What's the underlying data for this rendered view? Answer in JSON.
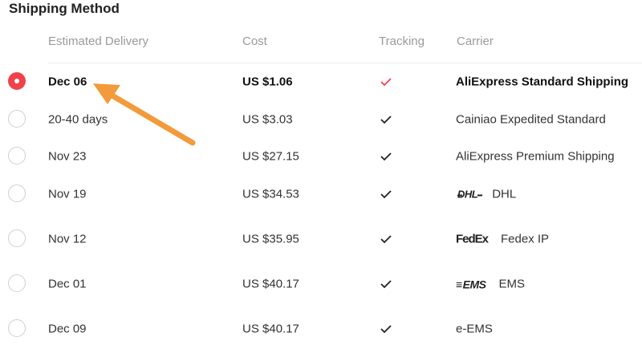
{
  "section_title": "Shipping Method",
  "columns": {
    "delivery": "Estimated Delivery",
    "cost": "Cost",
    "tracking": "Tracking",
    "carrier": "Carrier"
  },
  "rows": [
    {
      "delivery": "Dec 06",
      "cost": "US $1.06",
      "tracking": true,
      "carrier": "AliExpress Standard Shipping",
      "selected": true
    },
    {
      "delivery": "20-40 days",
      "cost": "US $3.03",
      "tracking": true,
      "carrier": "Cainiao Expedited Standard",
      "selected": false
    },
    {
      "delivery": "Nov 23",
      "cost": "US $27.15",
      "tracking": true,
      "carrier": "AliExpress Premium Shipping",
      "selected": false
    },
    {
      "delivery": "Nov 19",
      "cost": "US $34.53",
      "tracking": true,
      "carrier": "DHL",
      "logo": "DHL",
      "selected": false
    },
    {
      "delivery": "Nov 12",
      "cost": "US $35.95",
      "tracking": true,
      "carrier": "Fedex IP",
      "logo": "FedEx",
      "selected": false
    },
    {
      "delivery": "Dec 01",
      "cost": "US $40.17",
      "tracking": true,
      "carrier": "EMS",
      "logo": "EMS",
      "selected": false
    },
    {
      "delivery": "Dec 09",
      "cost": "US $40.17",
      "tracking": true,
      "carrier": "e-EMS",
      "selected": false
    }
  ],
  "colors": {
    "accent": "#f0424a",
    "annotation_arrow": "#f39a3a",
    "check_selected": "#f0424a",
    "check_default": "#222222"
  },
  "icons": {
    "tracking": "checkmark-icon",
    "radio": "radio-button",
    "annotation": "arrow-annotation"
  }
}
